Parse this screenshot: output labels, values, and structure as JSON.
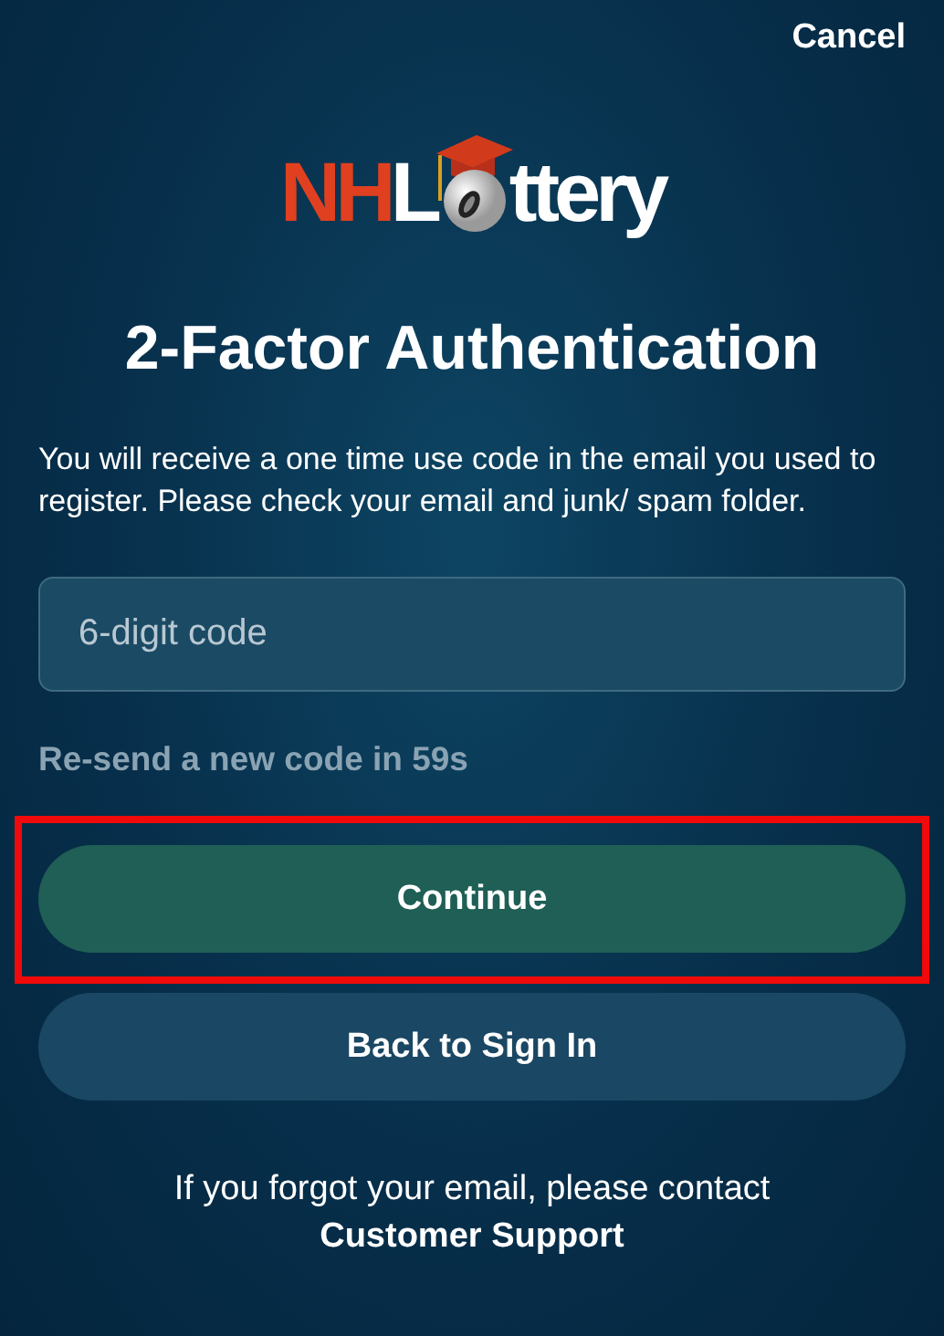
{
  "header": {
    "cancel": "Cancel"
  },
  "logo": {
    "red_text": "NH",
    "white_text_start": "L",
    "white_text_end": "ttery"
  },
  "title": "2-Factor Authentication",
  "instructions": "You will receive a one time use code in the email you used to register. Please check your email and junk/ spam folder.",
  "code_field": {
    "placeholder": "6-digit code"
  },
  "resend": "Re-send a new code in 59s",
  "buttons": [
    {
      "kind": "primary",
      "label": "Continue",
      "highlighted": true
    },
    {
      "kind": "secondary",
      "label": "Back to Sign In",
      "highlighted": false
    }
  ],
  "footer": {
    "text": "If you forgot your email, please contact",
    "link": "Customer Support"
  }
}
